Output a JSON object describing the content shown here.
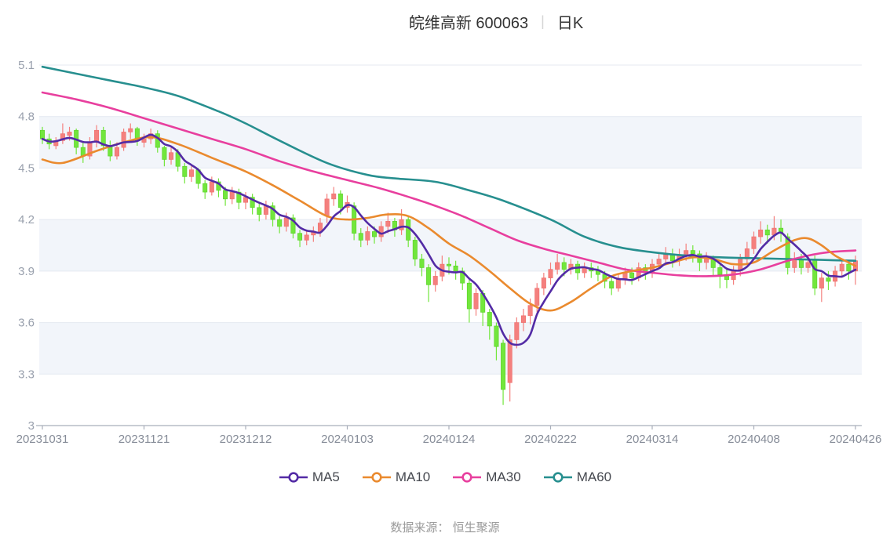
{
  "header": {
    "stock_title": "皖维高新 600063",
    "separator": "|",
    "period_label": "日K"
  },
  "footer": {
    "source_label": "数据来源： 恒生聚源"
  },
  "chart_data": {
    "type": "candlestick",
    "title": "皖维高新 600063 日K",
    "grid": {
      "stripes": true,
      "stripe_color": "#f2f5fa",
      "gridline_color": "#e4e9f1",
      "axis_color": "#a9afbb"
    },
    "colors": {
      "up": "#f4807e",
      "down": "#72e63c",
      "up_stroke": "#ef6e6c",
      "down_stroke": "#58d026"
    },
    "y_axis": {
      "min": 3.0,
      "max": 5.1,
      "tick_labels": [
        "5.1",
        "4.8",
        "4.5",
        "4.2",
        "3.9",
        "3.6",
        "3.3",
        "3"
      ],
      "tick_values": [
        5.1,
        4.8,
        4.5,
        4.2,
        3.9,
        3.6,
        3.3,
        3.0
      ]
    },
    "x_axis": {
      "tick_labels": [
        "20231031",
        "20231121",
        "20231212",
        "20240103",
        "20240124",
        "20240222",
        "20240314",
        "20240408",
        "20240426"
      ],
      "tick_indices": [
        0,
        15,
        30,
        45,
        60,
        75,
        90,
        105,
        120
      ],
      "n_bars": 121
    },
    "legend": [
      {
        "label": "MA5",
        "color": "#532ba5"
      },
      {
        "label": "MA10",
        "color": "#ea8a2e"
      },
      {
        "label": "MA30",
        "color": "#e83f9e"
      },
      {
        "label": "MA60",
        "color": "#278f8f"
      }
    ],
    "series": {
      "kline": {
        "name": "日K",
        "bars_format": [
          "open",
          "close",
          "low",
          "high"
        ],
        "bars": [
          [
            4.72,
            4.67,
            4.64,
            4.74
          ],
          [
            4.67,
            4.64,
            4.61,
            4.7
          ],
          [
            4.63,
            4.66,
            4.61,
            4.68
          ],
          [
            4.66,
            4.7,
            4.64,
            4.76
          ],
          [
            4.69,
            4.71,
            4.66,
            4.74
          ],
          [
            4.72,
            4.62,
            4.58,
            4.73
          ],
          [
            4.62,
            4.57,
            4.53,
            4.65
          ],
          [
            4.57,
            4.65,
            4.55,
            4.68
          ],
          [
            4.65,
            4.72,
            4.62,
            4.75
          ],
          [
            4.72,
            4.63,
            4.6,
            4.74
          ],
          [
            4.63,
            4.57,
            4.54,
            4.66
          ],
          [
            4.57,
            4.62,
            4.55,
            4.65
          ],
          [
            4.62,
            4.71,
            4.6,
            4.73
          ],
          [
            4.71,
            4.73,
            4.67,
            4.76
          ],
          [
            4.73,
            4.66,
            4.63,
            4.74
          ],
          [
            4.65,
            4.67,
            4.62,
            4.7
          ],
          [
            4.67,
            4.7,
            4.64,
            4.73
          ],
          [
            4.7,
            4.62,
            4.59,
            4.72
          ],
          [
            4.62,
            4.55,
            4.51,
            4.63
          ],
          [
            4.55,
            4.59,
            4.52,
            4.62
          ],
          [
            4.59,
            4.51,
            4.48,
            4.61
          ],
          [
            4.51,
            4.45,
            4.41,
            4.53
          ],
          [
            4.45,
            4.49,
            4.42,
            4.52
          ],
          [
            4.49,
            4.41,
            4.38,
            4.5
          ],
          [
            4.41,
            4.36,
            4.32,
            4.43
          ],
          [
            4.36,
            4.42,
            4.34,
            4.45
          ],
          [
            4.42,
            4.37,
            4.33,
            4.44
          ],
          [
            4.37,
            4.32,
            4.28,
            4.39
          ],
          [
            4.32,
            4.36,
            4.29,
            4.39
          ],
          [
            4.36,
            4.3,
            4.26,
            4.38
          ],
          [
            4.3,
            4.33,
            4.26,
            4.36
          ],
          [
            4.33,
            4.27,
            4.23,
            4.35
          ],
          [
            4.27,
            4.23,
            4.19,
            4.3
          ],
          [
            4.23,
            4.28,
            4.2,
            4.31
          ],
          [
            4.28,
            4.2,
            4.16,
            4.3
          ],
          [
            4.2,
            4.16,
            4.12,
            4.22
          ],
          [
            4.16,
            4.21,
            4.13,
            4.24
          ],
          [
            4.21,
            4.12,
            4.09,
            4.23
          ],
          [
            4.12,
            4.08,
            4.04,
            4.14
          ],
          [
            4.08,
            4.11,
            4.05,
            4.14
          ],
          [
            4.11,
            4.13,
            4.07,
            4.16
          ],
          [
            4.13,
            4.18,
            4.1,
            4.21
          ],
          [
            4.22,
            4.32,
            4.18,
            4.35
          ],
          [
            4.32,
            4.35,
            4.28,
            4.39
          ],
          [
            4.35,
            4.27,
            4.23,
            4.37
          ],
          [
            4.27,
            4.3,
            4.24,
            4.34
          ],
          [
            4.28,
            4.12,
            4.08,
            4.3
          ],
          [
            4.12,
            4.08,
            4.04,
            4.15
          ],
          [
            4.08,
            4.13,
            4.05,
            4.16
          ],
          [
            4.13,
            4.1,
            4.06,
            4.16
          ],
          [
            4.1,
            4.16,
            4.07,
            4.19
          ],
          [
            4.16,
            4.19,
            4.12,
            4.24
          ],
          [
            4.19,
            4.14,
            4.1,
            4.21
          ],
          [
            4.14,
            4.2,
            4.11,
            4.26
          ],
          [
            4.2,
            4.08,
            4.04,
            4.22
          ],
          [
            4.08,
            3.97,
            3.93,
            4.1
          ],
          [
            3.97,
            3.92,
            3.87,
            4.0
          ],
          [
            3.92,
            3.82,
            3.72,
            3.94
          ],
          [
            3.82,
            3.87,
            3.78,
            3.9
          ],
          [
            3.87,
            3.94,
            3.84,
            3.99
          ],
          [
            3.94,
            3.93,
            3.88,
            3.98
          ],
          [
            3.93,
            3.9,
            3.85,
            3.96
          ],
          [
            3.9,
            3.83,
            3.79,
            3.92
          ],
          [
            3.83,
            3.68,
            3.6,
            3.85
          ],
          [
            3.68,
            3.77,
            3.64,
            3.8
          ],
          [
            3.77,
            3.66,
            3.58,
            3.79
          ],
          [
            3.66,
            3.58,
            3.5,
            3.68
          ],
          [
            3.58,
            3.46,
            3.38,
            3.6
          ],
          [
            3.48,
            3.21,
            3.12,
            3.5
          ],
          [
            3.25,
            3.5,
            3.14,
            3.53
          ],
          [
            3.5,
            3.6,
            3.45,
            3.63
          ],
          [
            3.6,
            3.64,
            3.55,
            3.68
          ],
          [
            3.64,
            3.7,
            3.59,
            3.74
          ],
          [
            3.7,
            3.8,
            3.66,
            3.83
          ],
          [
            3.8,
            3.86,
            3.76,
            3.89
          ],
          [
            3.86,
            3.91,
            3.82,
            3.95
          ],
          [
            3.91,
            3.95,
            3.88,
            4.0
          ],
          [
            3.95,
            3.91,
            3.87,
            3.98
          ],
          [
            3.91,
            3.94,
            3.88,
            3.97
          ],
          [
            3.94,
            3.89,
            3.85,
            3.96
          ],
          [
            3.89,
            3.92,
            3.86,
            3.95
          ],
          [
            3.92,
            3.9,
            3.86,
            3.95
          ],
          [
            3.9,
            3.88,
            3.84,
            3.93
          ],
          [
            3.88,
            3.84,
            3.8,
            3.9
          ],
          [
            3.84,
            3.8,
            3.76,
            3.87
          ],
          [
            3.8,
            3.85,
            3.78,
            3.88
          ],
          [
            3.85,
            3.89,
            3.82,
            3.92
          ],
          [
            3.89,
            3.86,
            3.82,
            3.92
          ],
          [
            3.86,
            3.92,
            3.84,
            3.95
          ],
          [
            3.92,
            3.89,
            3.85,
            3.94
          ],
          [
            3.89,
            3.94,
            3.86,
            3.97
          ],
          [
            3.94,
            3.97,
            3.91,
            4.01
          ],
          [
            3.97,
            4.0,
            3.94,
            4.04
          ],
          [
            4.0,
            3.96,
            3.92,
            4.03
          ],
          [
            3.96,
            3.99,
            3.93,
            4.03
          ],
          [
            3.99,
            4.02,
            3.96,
            4.06
          ],
          [
            4.02,
            4.0,
            3.95,
            4.05
          ],
          [
            4.0,
            3.95,
            3.9,
            4.02
          ],
          [
            3.95,
            3.97,
            3.91,
            4.01
          ],
          [
            3.97,
            3.92,
            3.87,
            3.99
          ],
          [
            3.92,
            3.88,
            3.8,
            3.94
          ],
          [
            3.88,
            3.85,
            3.8,
            3.91
          ],
          [
            3.85,
            3.9,
            3.82,
            3.93
          ],
          [
            3.9,
            3.97,
            3.87,
            4.0
          ],
          [
            3.97,
            4.03,
            3.94,
            4.07
          ],
          [
            4.03,
            4.1,
            4.0,
            4.13
          ],
          [
            4.1,
            4.14,
            4.06,
            4.19
          ],
          [
            4.14,
            4.11,
            4.06,
            4.17
          ],
          [
            4.11,
            4.15,
            4.08,
            4.22
          ],
          [
            4.15,
            4.12,
            4.07,
            4.2
          ],
          [
            4.1,
            3.92,
            3.88,
            4.12
          ],
          [
            3.92,
            3.97,
            3.89,
            4.01
          ],
          [
            3.97,
            3.92,
            3.88,
            4.0
          ],
          [
            3.92,
            3.95,
            3.89,
            3.99
          ],
          [
            3.97,
            3.8,
            3.76,
            3.99
          ],
          [
            3.8,
            3.86,
            3.72,
            3.89
          ],
          [
            3.86,
            3.84,
            3.79,
            3.9
          ],
          [
            3.84,
            3.9,
            3.81,
            3.93
          ],
          [
            3.9,
            3.94,
            3.86,
            3.97
          ],
          [
            3.94,
            3.9,
            3.85,
            3.96
          ],
          [
            3.9,
            3.96,
            3.82,
            3.99
          ]
        ]
      },
      "ma5": {
        "name": "MA5",
        "derived": "sma5_of_closes"
      },
      "ma10": {
        "name": "MA10",
        "keypoints": [
          [
            0,
            4.55
          ],
          [
            3,
            4.53
          ],
          [
            8,
            4.6
          ],
          [
            12,
            4.65
          ],
          [
            16,
            4.68
          ],
          [
            20,
            4.64
          ],
          [
            25,
            4.56
          ],
          [
            30,
            4.48
          ],
          [
            34,
            4.4
          ],
          [
            38,
            4.31
          ],
          [
            42,
            4.22
          ],
          [
            45,
            4.2
          ],
          [
            48,
            4.21
          ],
          [
            51,
            4.23
          ],
          [
            54,
            4.22
          ],
          [
            57,
            4.15
          ],
          [
            60,
            4.06
          ],
          [
            63,
            3.99
          ],
          [
            66,
            3.9
          ],
          [
            69,
            3.8
          ],
          [
            72,
            3.71
          ],
          [
            75,
            3.67
          ],
          [
            78,
            3.72
          ],
          [
            81,
            3.8
          ],
          [
            84,
            3.87
          ],
          [
            87,
            3.9
          ],
          [
            90,
            3.92
          ],
          [
            93,
            3.95
          ],
          [
            96,
            3.98
          ],
          [
            99,
            3.97
          ],
          [
            102,
            3.94
          ],
          [
            105,
            3.95
          ],
          [
            108,
            4.02
          ],
          [
            111,
            4.08
          ],
          [
            113,
            4.09
          ],
          [
            115,
            4.05
          ],
          [
            117,
            3.99
          ],
          [
            119,
            3.95
          ],
          [
            120,
            3.93
          ]
        ]
      },
      "ma30": {
        "name": "MA30",
        "keypoints": [
          [
            0,
            4.94
          ],
          [
            5,
            4.9
          ],
          [
            10,
            4.85
          ],
          [
            15,
            4.79
          ],
          [
            20,
            4.73
          ],
          [
            25,
            4.67
          ],
          [
            30,
            4.61
          ],
          [
            35,
            4.54
          ],
          [
            40,
            4.48
          ],
          [
            45,
            4.43
          ],
          [
            50,
            4.38
          ],
          [
            55,
            4.32
          ],
          [
            58,
            4.28
          ],
          [
            62,
            4.22
          ],
          [
            66,
            4.15
          ],
          [
            70,
            4.08
          ],
          [
            74,
            4.03
          ],
          [
            78,
            3.99
          ],
          [
            82,
            3.95
          ],
          [
            86,
            3.91
          ],
          [
            90,
            3.89
          ],
          [
            94,
            3.875
          ],
          [
            98,
            3.87
          ],
          [
            102,
            3.88
          ],
          [
            106,
            3.91
          ],
          [
            110,
            3.96
          ],
          [
            113,
            3.99
          ],
          [
            116,
            4.01
          ],
          [
            120,
            4.02
          ]
        ]
      },
      "ma60": {
        "name": "MA60",
        "keypoints": [
          [
            0,
            5.09
          ],
          [
            5,
            5.05
          ],
          [
            10,
            5.01
          ],
          [
            15,
            4.97
          ],
          [
            20,
            4.92
          ],
          [
            26,
            4.83
          ],
          [
            30,
            4.76
          ],
          [
            35,
            4.66
          ],
          [
            42,
            4.53
          ],
          [
            48,
            4.46
          ],
          [
            52,
            4.44
          ],
          [
            58,
            4.42
          ],
          [
            63,
            4.37
          ],
          [
            68,
            4.31
          ],
          [
            75,
            4.2
          ],
          [
            80,
            4.1
          ],
          [
            85,
            4.04
          ],
          [
            90,
            4.01
          ],
          [
            95,
            3.99
          ],
          [
            100,
            3.98
          ],
          [
            105,
            3.975
          ],
          [
            110,
            3.97
          ],
          [
            115,
            3.965
          ],
          [
            120,
            3.96
          ]
        ]
      }
    }
  }
}
